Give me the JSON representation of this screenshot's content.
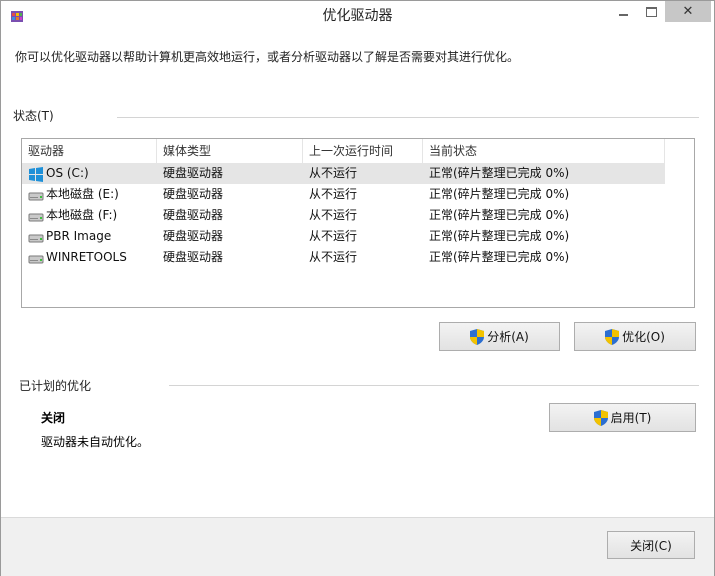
{
  "window": {
    "title": "优化驱动器",
    "close_glyph": "✕"
  },
  "description": "你可以优化驱动器以帮助计算机更高效地运行，或者分析驱动器以了解是否需要对其进行优化。",
  "status": {
    "label": "状态(T)",
    "columns": [
      "驱动器",
      "媒体类型",
      "上一次运行时间",
      "当前状态"
    ],
    "drives": [
      {
        "name": "OS (C:)",
        "icon": "windows-drive-icon",
        "media": "硬盘驱动器",
        "last_run": "从不运行",
        "status": "正常(碎片整理已完成 0%)",
        "selected": true
      },
      {
        "name": "本地磁盘 (E:)",
        "icon": "hard-drive-icon",
        "media": "硬盘驱动器",
        "last_run": "从不运行",
        "status": "正常(碎片整理已完成 0%)",
        "selected": false
      },
      {
        "name": "本地磁盘 (F:)",
        "icon": "hard-drive-icon",
        "media": "硬盘驱动器",
        "last_run": "从不运行",
        "status": "正常(碎片整理已完成 0%)",
        "selected": false
      },
      {
        "name": "PBR Image",
        "icon": "hard-drive-icon",
        "media": "硬盘驱动器",
        "last_run": "从不运行",
        "status": "正常(碎片整理已完成 0%)",
        "selected": false
      },
      {
        "name": "WINRETOOLS",
        "icon": "hard-drive-icon",
        "media": "硬盘驱动器",
        "last_run": "从不运行",
        "status": "正常(碎片整理已完成 0%)",
        "selected": false
      }
    ],
    "analyze_label": "分析(A)",
    "optimize_label": "优化(O)"
  },
  "scheduled": {
    "label": "已计划的优化",
    "state": "关闭",
    "description": "驱动器未自动优化。",
    "enable_label": "启用(T)"
  },
  "footer": {
    "close_label": "关闭(C)"
  },
  "colors": {
    "windows_blue": "#1e90d8",
    "shield_blue": "#2c6fd1",
    "shield_yellow": "#f2c200",
    "selected_row": "#e5e5e5"
  }
}
